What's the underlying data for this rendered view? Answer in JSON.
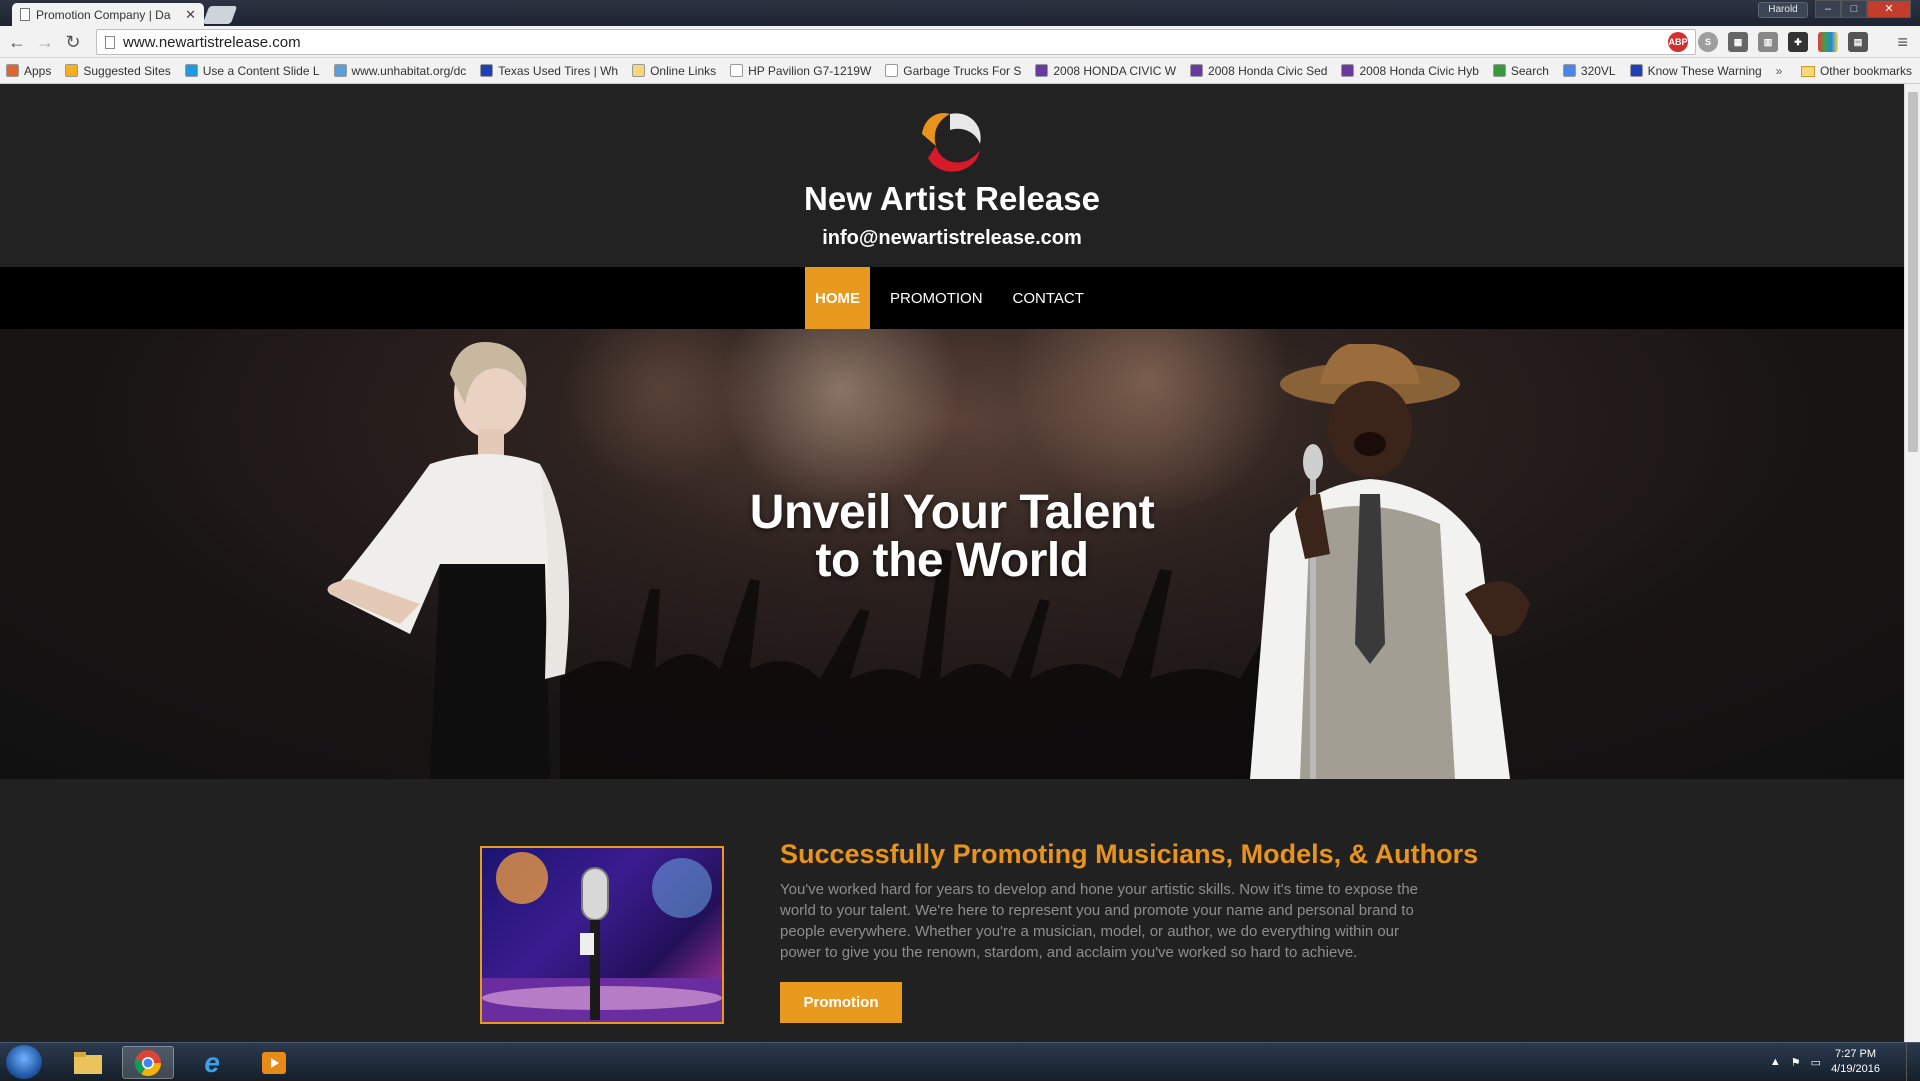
{
  "browser": {
    "tab_title": "Promotion Company | Da",
    "user_name": "Harold",
    "url": "www.newartistrelease.com",
    "bookmarks": [
      {
        "label": "Apps",
        "color": "#e0662f"
      },
      {
        "label": "Suggested Sites",
        "color": "#f2b01e"
      },
      {
        "label": "Use a Content Slide L",
        "color": "#1e9be0"
      },
      {
        "label": "www.unhabitat.org/dc",
        "color": "#5aa0d8"
      },
      {
        "label": "Texas Used Tires | Wh",
        "color": "#1e3fb8"
      },
      {
        "label": "Online Links",
        "color": "#f6d77a"
      },
      {
        "label": "HP Pavilion G7-1219W",
        "color": "#ffffff"
      },
      {
        "label": "Garbage Trucks For S",
        "color": "#ffffff"
      },
      {
        "label": "2008 HONDA CIVIC W",
        "color": "#6a3aa0"
      },
      {
        "label": "2008 Honda Civic Sed",
        "color": "#6a3aa0"
      },
      {
        "label": "2008 Honda Civic Hyb",
        "color": "#6a3aa0"
      },
      {
        "label": "Search",
        "color": "#3a9a3a"
      },
      {
        "label": "320VL",
        "color": "#4a85e8"
      },
      {
        "label": "Know These Warning",
        "color": "#1e3fb8"
      }
    ],
    "more_bookmarks": "»",
    "other_bookmarks": "Other bookmarks"
  },
  "site": {
    "title": "New Artist Release",
    "email": "info@newartistrelease.com",
    "nav": [
      {
        "label": "HOME",
        "active": true
      },
      {
        "label": "PROMOTION",
        "active": false
      },
      {
        "label": "CONTACT",
        "active": false
      }
    ],
    "hero": {
      "line1": "Unveil Your Talent",
      "line2": "to the World"
    },
    "feature": {
      "title": "Successfully Promoting Musicians, Models, & Authors",
      "text": "You've worked hard for years to develop and hone your artistic skills. Now it's time to expose the world to your talent. We're here to represent you and promote your name and personal brand to people everywhere. Whether you're a musician, model, or author, we do everything within our power to give you the renown, stardom, and acclaim you've worked so hard to achieve.",
      "button": "Promotion"
    },
    "colors": {
      "accent": "#e89a1f",
      "title_accent": "#e8931c"
    }
  },
  "taskbar": {
    "time": "7:27 PM",
    "date": "4/19/2016"
  }
}
